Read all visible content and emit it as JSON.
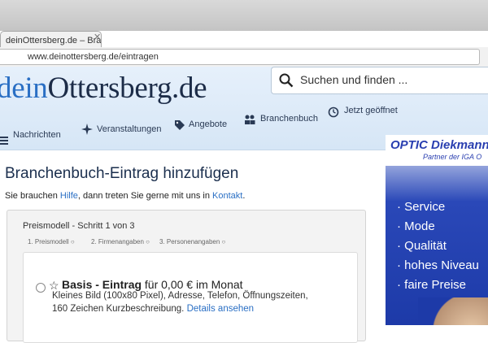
{
  "browser": {
    "tab_title": "deinOttersberg.de – Branch",
    "tab_close": "✕",
    "url": "www.deinottersberg.de/eintragen"
  },
  "site": {
    "logo_prefix": "dein",
    "logo_main": "Ottersberg.de",
    "search_placeholder": "Suchen und finden ...",
    "nav": [
      {
        "label": "Nachrichten",
        "icon": "list-icon"
      },
      {
        "label": "Veranstaltungen",
        "icon": "sparkle-icon"
      },
      {
        "label": "Angebote",
        "icon": "tag-icon"
      },
      {
        "label": "Branchenbuch",
        "icon": "people-icon"
      },
      {
        "label": "Jetzt geöffnet",
        "icon": "clock-icon"
      }
    ]
  },
  "main": {
    "title": "Branchenbuch-Eintrag hinzufügen",
    "subtitle_pre": "Sie brauchen ",
    "subtitle_link1": "Hilfe",
    "subtitle_mid": ", dann treten Sie gerne mit uns in ",
    "subtitle_link2": "Kontakt",
    "subtitle_post": ".",
    "steps_title": "Preismodell - Schritt 1 von 3",
    "steps": [
      "1. Preismodell",
      "2. Firmenangaben",
      "3. Personenangaben"
    ],
    "option": {
      "title_bold": "Basis - Eintrag",
      "title_rest": " für 0,00 € im Monat",
      "desc": "Kleines Bild (100x80 Pixel), Adresse, Telefon, Öffnungszeiten, 160 Zeichen Kurzbeschreibung. ",
      "details_link": "Details ansehen"
    }
  },
  "ad": {
    "brand": "OPTIC Diekmann",
    "sub": "Partner der IGA O",
    "items": [
      "· Service",
      "· Mode",
      "· Qualität",
      "· hohes Niveau",
      "· faire Preise"
    ]
  }
}
